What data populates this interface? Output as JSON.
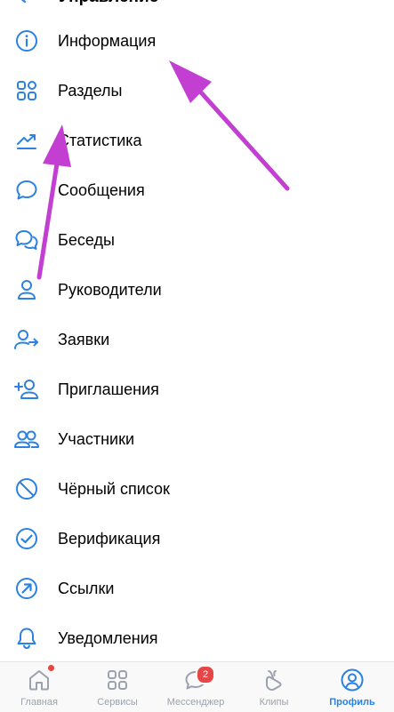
{
  "header": {
    "title": "Управление"
  },
  "menu": {
    "items": [
      {
        "label": "Информация",
        "icon": "info-icon"
      },
      {
        "label": "Разделы",
        "icon": "sections-grid-icon"
      },
      {
        "label": "Статистика",
        "icon": "statistics-chart-icon"
      },
      {
        "label": "Сообщения",
        "icon": "message-bubble-icon"
      },
      {
        "label": "Беседы",
        "icon": "chats-icon"
      },
      {
        "label": "Руководители",
        "icon": "user-icon"
      },
      {
        "label": "Заявки",
        "icon": "user-request-icon"
      },
      {
        "label": "Приглашения",
        "icon": "user-add-icon"
      },
      {
        "label": "Участники",
        "icon": "users-icon"
      },
      {
        "label": "Чёрный список",
        "icon": "block-icon"
      },
      {
        "label": "Верификация",
        "icon": "check-circle-icon"
      },
      {
        "label": "Ссылки",
        "icon": "link-arrow-icon"
      },
      {
        "label": "Уведомления",
        "icon": "bell-icon"
      }
    ]
  },
  "tabbar": {
    "tabs": [
      {
        "label": "Главная",
        "icon": "home-icon",
        "active": false
      },
      {
        "label": "Сервисы",
        "icon": "services-grid-icon",
        "active": false
      },
      {
        "label": "Мессенджер",
        "icon": "messenger-icon",
        "active": false,
        "badge": "2"
      },
      {
        "label": "Клипы",
        "icon": "clips-icon",
        "active": false
      },
      {
        "label": "Профиль",
        "icon": "profile-icon",
        "active": true
      }
    ]
  },
  "colors": {
    "accent": "#2d81e0",
    "icon": "#2d81e0",
    "annotation_arrow": "#c23fd1",
    "badge": "#e64646",
    "inactive_tab": "#99a2ad"
  }
}
